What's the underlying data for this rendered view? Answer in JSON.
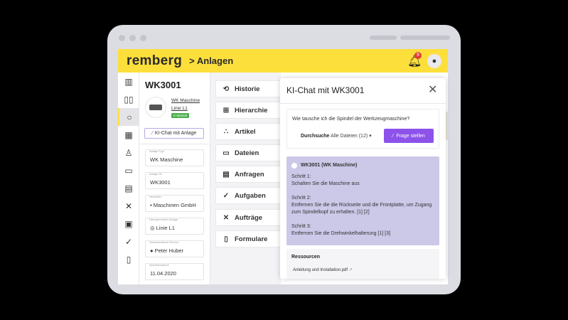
{
  "header": {
    "logo": "remberg",
    "breadcrumb": "> Anlagen",
    "notification_count": "9"
  },
  "sidebar": {
    "icons": [
      "dashboard-icon",
      "map-icon",
      "asset-icon",
      "building-icon",
      "person-icon",
      "folder-icon",
      "chat-icon",
      "tools-icon",
      "calendar-icon",
      "check-icon",
      "clipboard-icon"
    ],
    "active_index": 2
  },
  "asset": {
    "title": "WK3001",
    "type_link": "WK Maschine",
    "line_link": "Linie L1",
    "status": "In Betrieb",
    "ai_button": "KI-Chat mit Anlage",
    "fields": [
      {
        "label": "Anlage Typ*",
        "value": "WK Maschine"
      },
      {
        "label": "Anlage ID",
        "value": "WK3001"
      },
      {
        "label": "Hersteller",
        "value": "Maschinen GmbH"
      },
      {
        "label": "Übergeordnete Anlage",
        "value": "Linie L1"
      },
      {
        "label": "Verantwortliche Person",
        "value": "Peter Huber"
      },
      {
        "label": "Inbetriebnahme",
        "value": "11.04.2020"
      }
    ]
  },
  "menu": [
    {
      "label": "Historie",
      "icon": "⟲"
    },
    {
      "label": "Hierarchie",
      "icon": "⊞"
    },
    {
      "label": "Artikel",
      "icon": "∴"
    },
    {
      "label": "Dateien",
      "icon": "▭"
    },
    {
      "label": "Anfragen",
      "icon": "▤"
    },
    {
      "label": "Aufgaben",
      "icon": "✓"
    },
    {
      "label": "Aufträge",
      "icon": "✕"
    },
    {
      "label": "Formulare",
      "icon": "▯"
    }
  ],
  "chat": {
    "title": "KI-Chat mit WK3001",
    "question": "Wie tausche ich die Spindel der Werkzeugmaschine?",
    "scope_label": "Durchsuche",
    "scope_value": "Alle Dateien (12)",
    "ask_button": "Frage stellen",
    "answer_header": "WK3001 (WK Maschine)",
    "steps": [
      {
        "title": "Schritt 1:",
        "text": "Schalten Sie die Maschine aus"
      },
      {
        "title": "Schritt 2:",
        "text": "Entfernen Sie die die Rückseite und die Frontplatte, um Zugang zum Spindelkopf zu erhalten. [1] [2]"
      },
      {
        "title": "Schritt 3:",
        "text": "Entfernen Sie die Drehwinkelhalterung [1] [3]"
      }
    ],
    "resources_title": "Ressourcen",
    "resource_file": "Anleitung und Installation.pdf"
  },
  "colors": {
    "brand_yellow": "#fddf3c",
    "accent_purple": "#8c52ea",
    "answer_bg": "#cbc8e8"
  }
}
